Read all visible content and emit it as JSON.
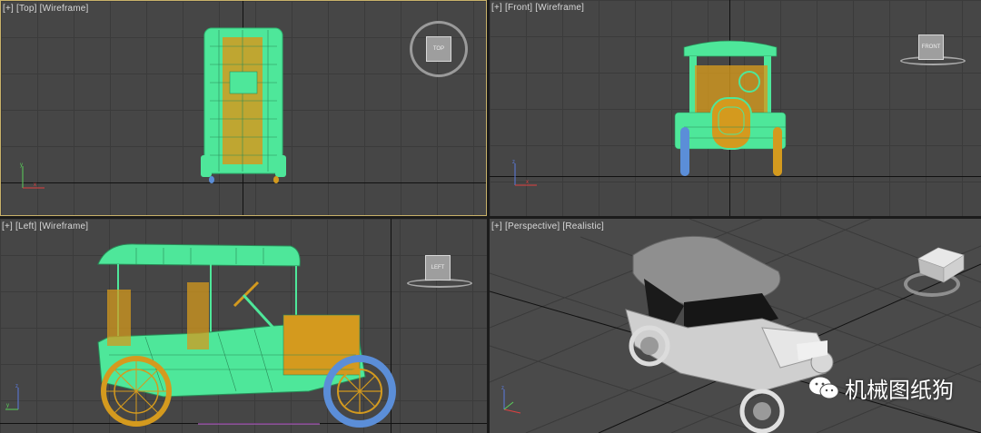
{
  "viewports": {
    "top": {
      "label_plus": "[+]",
      "label_view": "[Top]",
      "label_mode": "[Wireframe]",
      "cube_text": "TOP"
    },
    "front": {
      "label_plus": "[+]",
      "label_view": "[Front]",
      "label_mode": "[Wireframe]",
      "cube_text": "FRONT"
    },
    "left": {
      "label_plus": "[+]",
      "label_view": "[Left]",
      "label_mode": "[Wireframe]",
      "cube_text": "LEFT"
    },
    "perspective": {
      "label_plus": "[+]",
      "label_view": "[Perspective]",
      "label_mode": "[Realistic]"
    }
  },
  "watermark": {
    "text": "机械图纸狗"
  },
  "colors": {
    "wire_green": "#4ee79a",
    "wire_orange": "#d49a1e",
    "wheel_blue": "#5b8ed8",
    "active_border": "#c9b26a",
    "viewport_bg": "#464646"
  },
  "icons": {
    "viewcube": "viewcube-icon",
    "axis": "axis-tripod-icon",
    "watermark_logo": "wechat-logo-icon"
  }
}
